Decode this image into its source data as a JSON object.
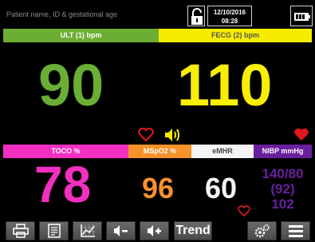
{
  "header": {
    "patient_placeholder": "Patient name, ID & gestational age",
    "date": "12/10/2016",
    "time": "08:28"
  },
  "channels": {
    "ult": {
      "label": "ULT (1) bpm",
      "value": "90"
    },
    "fecg": {
      "label": "FECG (2) bpm",
      "value": "110"
    }
  },
  "parameters": {
    "toco": {
      "label": "TOCO %",
      "value": "78"
    },
    "mspo2": {
      "label": "MSpO2 %",
      "value": "96"
    },
    "emhr": {
      "label": "eMHR",
      "value": "60"
    },
    "nibp": {
      "label": "NIBP mmHg",
      "line1": "140/80",
      "line2": "(92)",
      "line3": "102"
    }
  },
  "toolbar": {
    "trend_label": "Trend",
    "icons": [
      "print-icon",
      "report-icon",
      "chart-icon",
      "volume-down-icon",
      "volume-up-icon",
      "settings-icon",
      "menu-icon"
    ]
  },
  "colors": {
    "ult": "#6cae33",
    "fecg": "#f5ec00",
    "toco": "#f22fc0",
    "mspo2": "#f7922a",
    "emhr": "#f4f4f4",
    "nibp": "#6a1f9e",
    "alarm": "#e0191f"
  }
}
